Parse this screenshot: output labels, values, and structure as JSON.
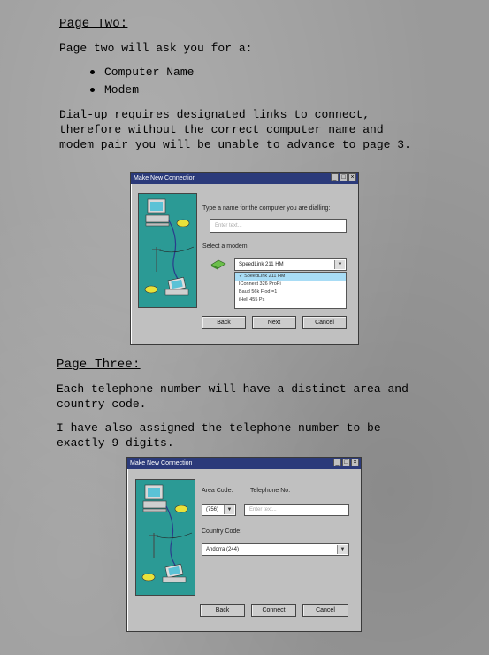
{
  "page_two": {
    "heading": "Page Two:",
    "intro": "Page two will ask you for a:",
    "bullets": [
      "Computer Name",
      "Modem"
    ],
    "description": "Dial-up requires designated links to connect,\ntherefore without the correct computer name and\nmodem pair you will be unable to advance to page 3."
  },
  "dialog1": {
    "title": "Make New Connection",
    "name_prompt": "Type a name for the computer you are dialling:",
    "name_placeholder": "Enter text...",
    "modem_prompt": "Select a modem:",
    "modem_selected": "SpeedLink 211 HM",
    "modem_options": [
      "✓ SpeedLink 211 HM",
      "IConnect 326 ProPi",
      "Baud 56k Flod =1",
      "iHell 455 Ps"
    ],
    "buttons": {
      "back": "Back",
      "next": "Next",
      "cancel": "Cancel"
    }
  },
  "page_three": {
    "heading": "Page Three:",
    "para1": "Each telephone number will have a distinct area and\ncountry code.",
    "para2": "I have also assigned the telephone number to be\nexactly 9 digits."
  },
  "dialog2": {
    "title": "Make New Connection",
    "area_label": "Area Code:",
    "phone_label": "Telephone No:",
    "area_value": "(756)",
    "phone_placeholder": "Enter text...",
    "country_label": "Country Code:",
    "country_value": "Andorra (244)",
    "buttons": {
      "back": "Back",
      "connect": "Connect",
      "cancel": "Cancel"
    }
  },
  "colors": {
    "illustration_bg": "#2b9a95",
    "titlebar": "#2b3a7a",
    "selected_item": "#a8dcf5"
  }
}
